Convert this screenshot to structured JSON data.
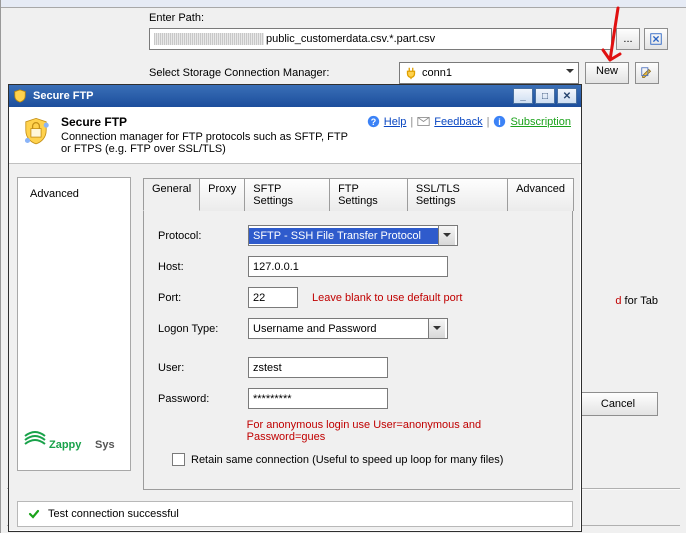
{
  "bg": {
    "enter_path_label": "Enter Path:",
    "path_value": "public_customerdata.csv.*.part.csv",
    "browse_label": "...",
    "select_conn_label": "Select Storage Connection Manager:",
    "conn_value": "conn1",
    "new_label": "New",
    "hint_fragment_red": "d",
    "hint_fragment_rest": " for Tab",
    "cancel_label": "Cancel"
  },
  "dlg": {
    "title": "Secure FTP",
    "header_title": "Secure FTP",
    "header_sub": "Connection manager for FTP protocols such as SFTP, FTP or FTPS (e.g. FTP over SSL/TLS)",
    "links": {
      "help": "Help",
      "feedback": "Feedback",
      "subscription": "Subscription "
    },
    "sidebar": {
      "advanced": "Advanced"
    },
    "tabs": [
      "General",
      "Proxy",
      "SFTP Settings",
      "FTP Settings",
      "SSL/TLS Settings",
      "Advanced"
    ],
    "form": {
      "protocol_label": "Protocol:",
      "protocol_value": "SFTP - SSH File Transfer Protocol",
      "host_label": "Host:",
      "host_value": "127.0.0.1",
      "port_label": "Port:",
      "port_value": "22",
      "port_hint": "Leave blank to use default port",
      "logon_label": "Logon Type:",
      "logon_value": "Username and Password",
      "user_label": "User:",
      "user_value": "zstest",
      "password_label": "Password:",
      "password_value": "*********",
      "anon_hint": "For anonymous login use User=anonymous and Password=gues",
      "retain_label": "Retain same connection (Useful to speed up loop for many files)"
    },
    "status": "Test connection successful",
    "logo": {
      "z": "Zappy",
      "sys": "Sys"
    }
  }
}
